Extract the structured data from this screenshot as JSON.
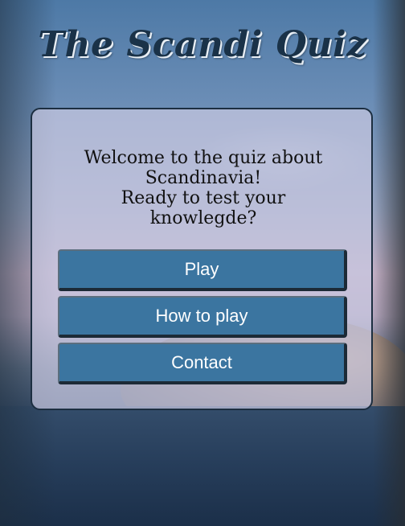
{
  "header": {
    "title": "The Scandi Quiz"
  },
  "card": {
    "welcome_line_1": "Welcome to the quiz about",
    "welcome_line_2": "Scandinavia!",
    "welcome_line_3": "Ready to test your",
    "welcome_line_4": "knowlegde?"
  },
  "buttons": {
    "play": "Play",
    "how_to_play": "How to play",
    "contact": "Contact"
  },
  "colors": {
    "button_bg": "#3b75a0",
    "title_color": "#1a3248",
    "card_bg": "#c8c8e0"
  }
}
